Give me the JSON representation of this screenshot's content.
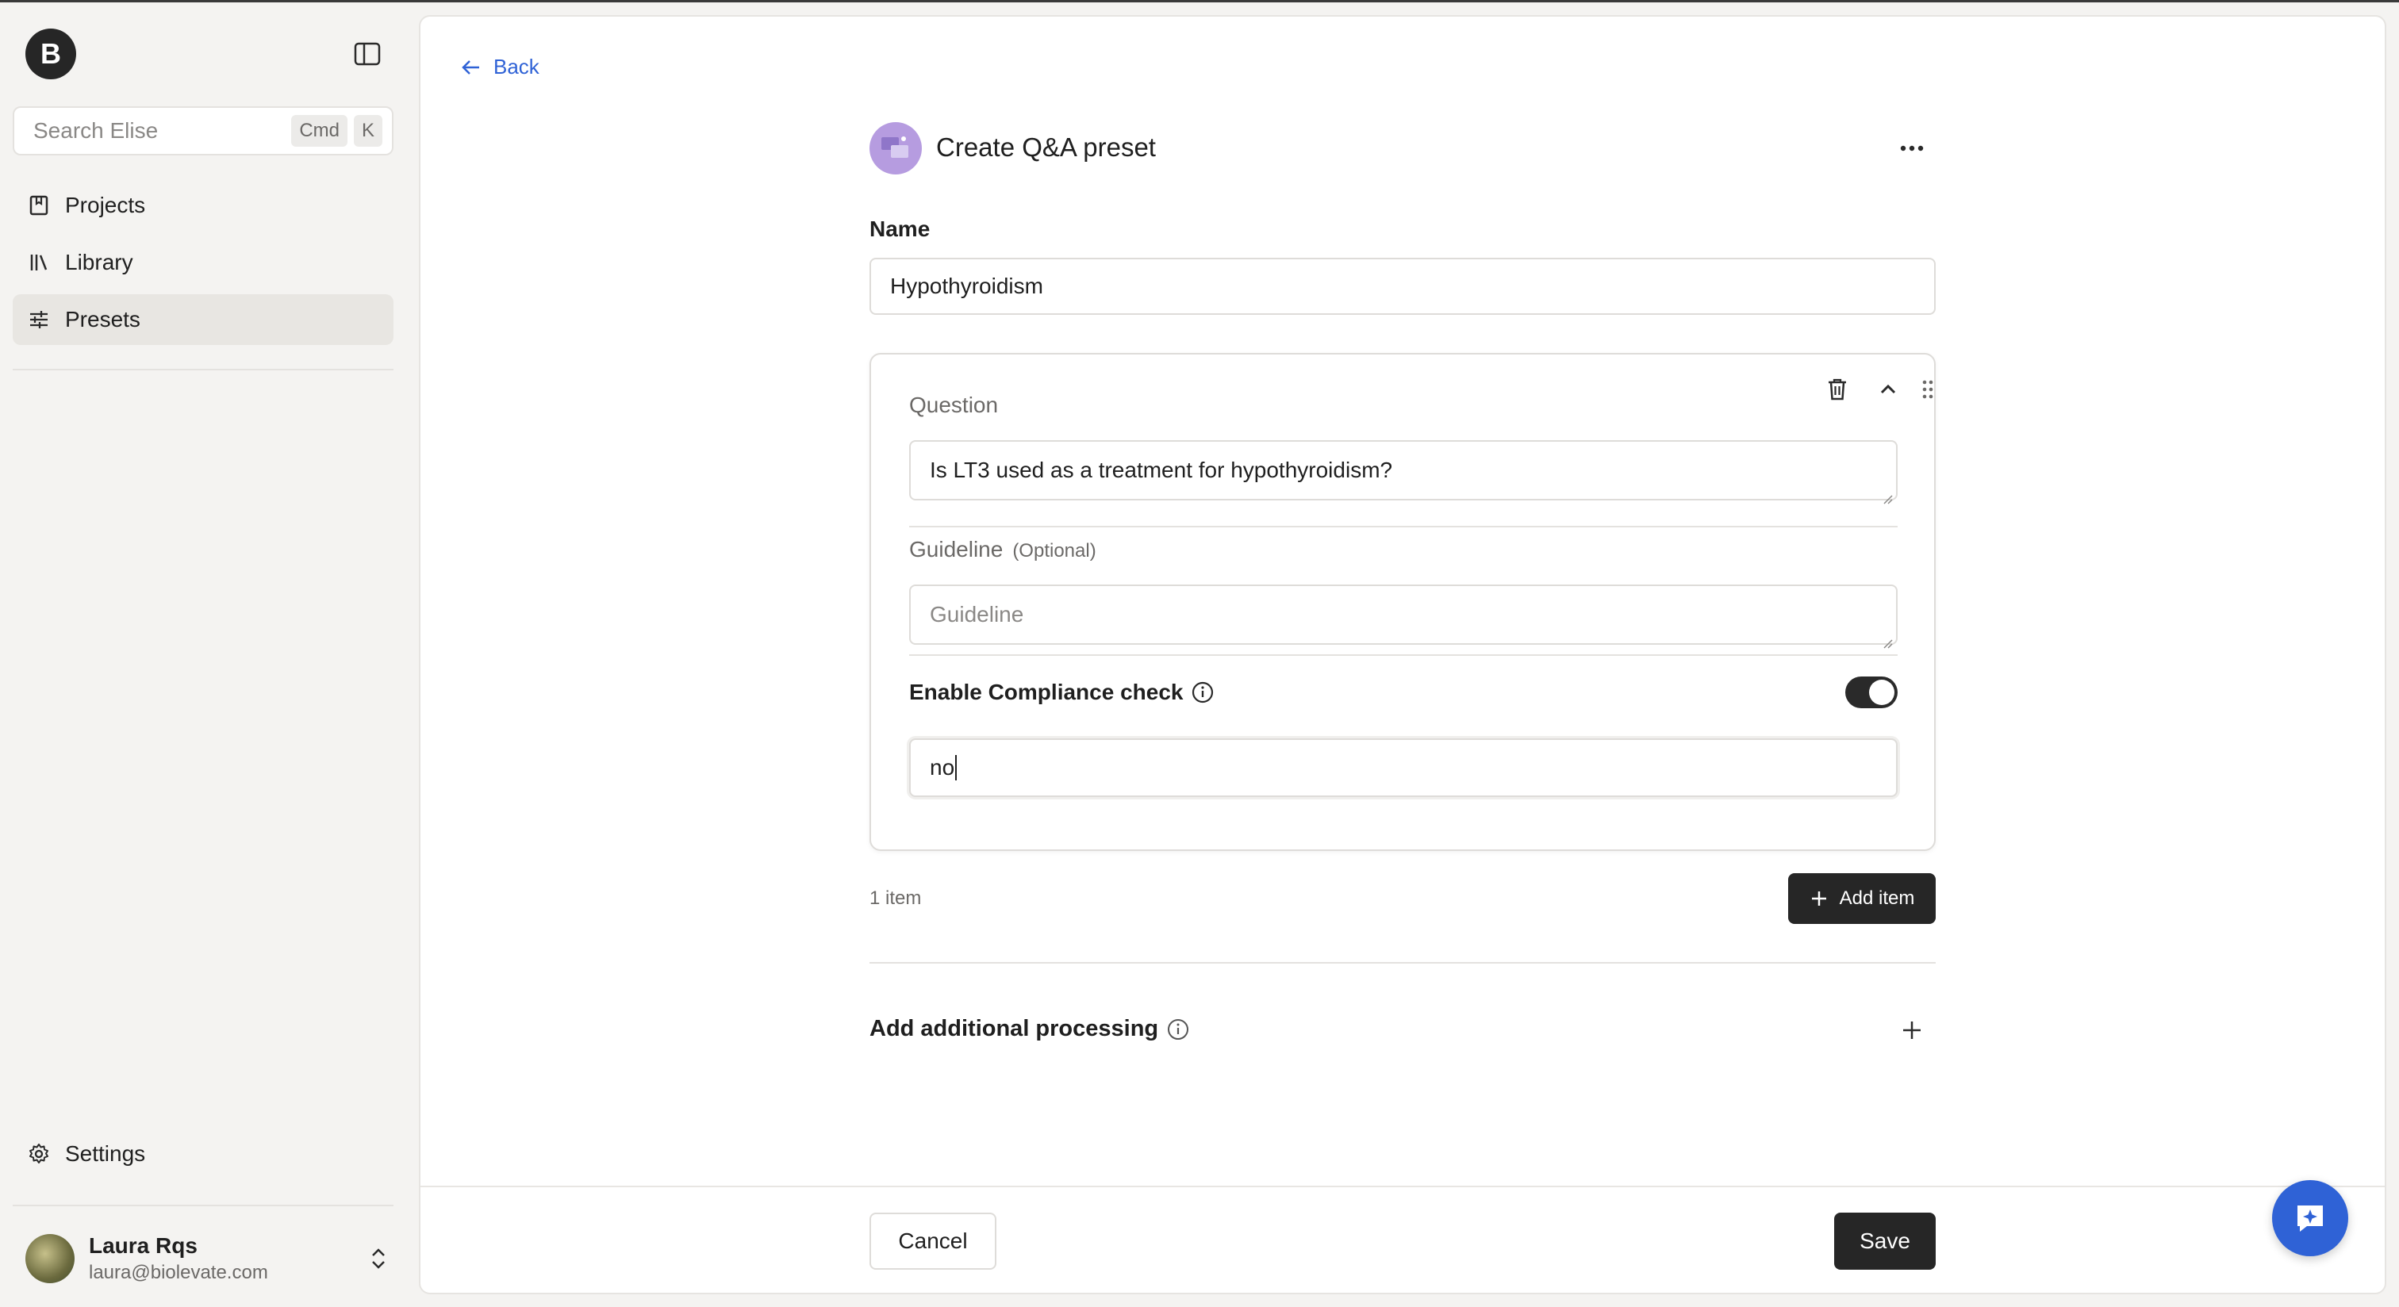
{
  "sidebar": {
    "logo_letter": "B",
    "search": {
      "placeholder": "Search Elise",
      "shortcut_cmd": "Cmd",
      "shortcut_key": "K"
    },
    "items": [
      {
        "label": "Projects",
        "icon": "book-icon"
      },
      {
        "label": "Library",
        "icon": "library-icon"
      },
      {
        "label": "Presets",
        "icon": "sliders-icon",
        "active": true
      }
    ],
    "settings_label": "Settings",
    "user": {
      "name": "Laura Rqs",
      "email": "laura@biolevate.com"
    }
  },
  "main": {
    "back_label": "Back",
    "title": "Create Q&A preset",
    "name_label": "Name",
    "name_value": "Hypothyroidism",
    "card": {
      "question_label": "Question",
      "question_value": "Is LT3 used as a treatment for hypothyroidism?",
      "guideline_label": "Guideline",
      "guideline_optional": "(Optional)",
      "guideline_placeholder": "Guideline",
      "compliance_label": "Enable Compliance check",
      "compliance_enabled": true,
      "compliance_value": "no"
    },
    "item_count": "1 item",
    "add_item_label": "Add item",
    "processing_label": "Add additional processing",
    "cancel_label": "Cancel",
    "save_label": "Save"
  },
  "colors": {
    "accent": "#2f62d6",
    "primary_button": "#262626",
    "sidebar_bg": "#f4f3f1",
    "preset_icon": "#b69ce0"
  }
}
